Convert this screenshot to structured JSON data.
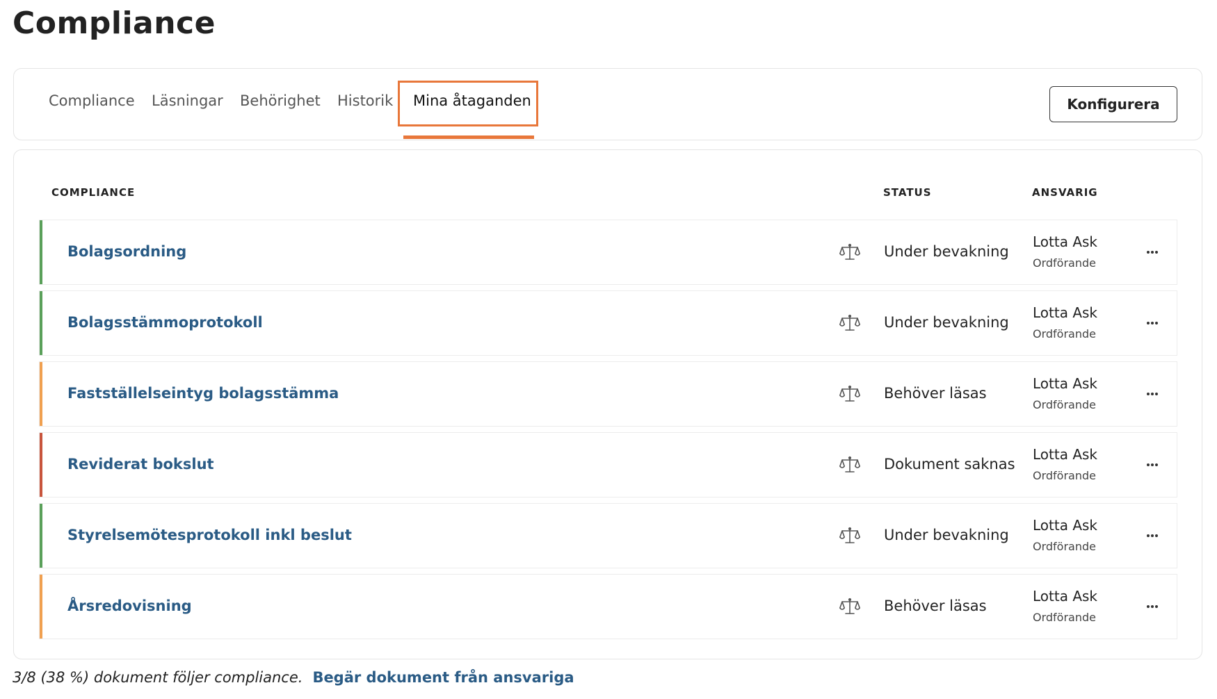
{
  "page": {
    "title": "Compliance"
  },
  "tabs": [
    {
      "label": "Compliance",
      "active": false
    },
    {
      "label": "Läsningar",
      "active": false
    },
    {
      "label": "Behörighet",
      "active": false
    },
    {
      "label": "Historik",
      "active": false
    },
    {
      "label": "Mina åtaganden",
      "active": true
    }
  ],
  "toolbar": {
    "configure_label": "Konfigurera"
  },
  "table": {
    "headers": {
      "compliance": "COMPLIANCE",
      "status": "STATUS",
      "responsible": "ANSVARIG"
    },
    "rows": [
      {
        "name": "Bolagsordning",
        "status": "Under bevakning",
        "person": "Lotta Ask",
        "role": "Ordförande",
        "status_color": "#5aa05a",
        "icon": "scale-icon"
      },
      {
        "name": "Bolagsstämmoprotokoll",
        "status": "Under bevakning",
        "person": "Lotta Ask",
        "role": "Ordförande",
        "status_color": "#5aa05a",
        "icon": "scale-icon"
      },
      {
        "name": "Fastställelseintyg bolagsstämma",
        "status": "Behöver läsas",
        "person": "Lotta Ask",
        "role": "Ordförande",
        "status_color": "#f0a050",
        "icon": "scale-icon"
      },
      {
        "name": "Reviderat bokslut",
        "status": "Dokument saknas",
        "person": "Lotta Ask",
        "role": "Ordförande",
        "status_color": "#c8553d",
        "icon": "scale-icon"
      },
      {
        "name": "Styrelsemötesprotokoll inkl beslut",
        "status": "Under bevakning",
        "person": "Lotta Ask",
        "role": "Ordförande",
        "status_color": "#5aa05a",
        "icon": "scale-icon"
      },
      {
        "name": "Årsredovisning",
        "status": "Behöver läsas",
        "person": "Lotta Ask",
        "role": "Ordförande",
        "status_color": "#f0a050",
        "icon": "scale-icon"
      }
    ]
  },
  "footer": {
    "summary": "3/8 (38 %) dokument följer compliance.",
    "link": "Begär dokument från ansvariga"
  },
  "colors": {
    "accent": "#e8773a",
    "link": "#2a5b85",
    "ok": "#5aa05a",
    "warning": "#f0a050",
    "error": "#c8553d"
  }
}
